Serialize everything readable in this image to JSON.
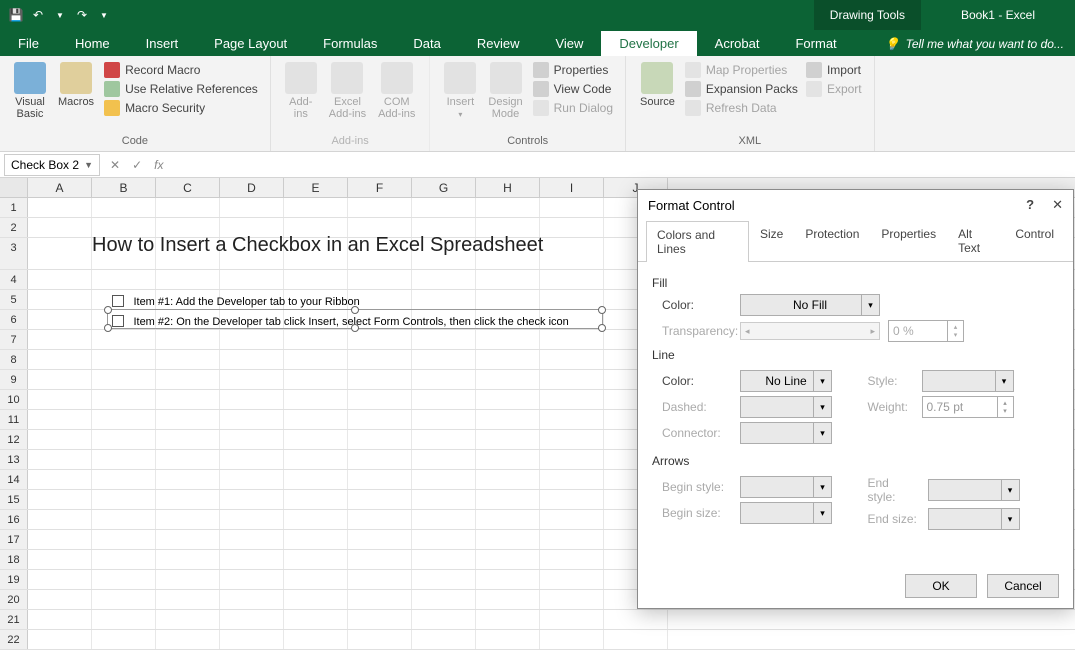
{
  "title_bar": {
    "drawing_tools": "Drawing Tools",
    "book": "Book1 - Excel"
  },
  "menu": {
    "file": "File",
    "home": "Home",
    "insert": "Insert",
    "layout": "Page Layout",
    "formulas": "Formulas",
    "data": "Data",
    "review": "Review",
    "view": "View",
    "developer": "Developer",
    "acrobat": "Acrobat",
    "format": "Format",
    "tellme": "Tell me what you want to do..."
  },
  "ribbon": {
    "code": {
      "visual_basic": "Visual\nBasic",
      "macros": "Macros",
      "record": "Record Macro",
      "relative": "Use Relative References",
      "security": "Macro Security",
      "label": "Code"
    },
    "addins": {
      "addins": "Add-\nins",
      "excel": "Excel\nAdd-ins",
      "com": "COM\nAdd-ins",
      "label": "Add-ins"
    },
    "controls": {
      "insert": "Insert",
      "design": "Design\nMode",
      "properties": "Properties",
      "view_code": "View Code",
      "run_dialog": "Run Dialog",
      "label": "Controls"
    },
    "xml": {
      "source": "Source",
      "map_props": "Map Properties",
      "expansion": "Expansion Packs",
      "refresh": "Refresh Data",
      "import": "Import",
      "export": "Export",
      "label": "XML"
    }
  },
  "formula_bar": {
    "name_box": "Check Box 2"
  },
  "sheet": {
    "cols": [
      "A",
      "B",
      "C",
      "D",
      "E",
      "F",
      "G",
      "H",
      "I",
      "J"
    ],
    "title": "How to Insert a Checkbox in an Excel Spreadsheet",
    "item1": "Item #1: Add the Developer tab to your Ribbon",
    "item2": "Item #2: On the Developer tab click Insert, select Form Controls, then click the check icon"
  },
  "dialog": {
    "title": "Format Control",
    "tabs": [
      "Colors and Lines",
      "Size",
      "Protection",
      "Properties",
      "Alt Text",
      "Control"
    ],
    "fill": {
      "heading": "Fill",
      "color": "Color:",
      "nofill": "No Fill",
      "transparency": "Transparency:",
      "pct": "0 %"
    },
    "line": {
      "heading": "Line",
      "color": "Color:",
      "noline": "No Line",
      "style": "Style:",
      "dashed": "Dashed:",
      "weight": "Weight:",
      "weight_val": "0.75 pt",
      "connector": "Connector:"
    },
    "arrows": {
      "heading": "Arrows",
      "bstyle": "Begin style:",
      "estyle": "End style:",
      "bsize": "Begin size:",
      "esize": "End size:"
    },
    "ok": "OK",
    "cancel": "Cancel"
  }
}
